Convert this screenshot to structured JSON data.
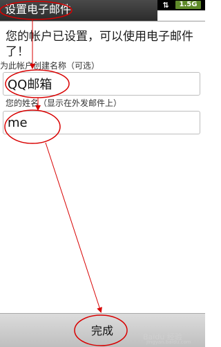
{
  "status_bar": {
    "arrows_icon": "sync-arrows-icon",
    "network_badge": "1.5G"
  },
  "header": {
    "title": "设置电子邮件"
  },
  "main": {
    "intro": "您的帐户已设置，可以使用电子邮件了！",
    "account_name_label": "为此帐户创建名称（可选）",
    "account_name_value": "QQ邮箱",
    "your_name_label": "您的姓名（显示在外发邮件上）",
    "your_name_value": "me"
  },
  "footer": {
    "done_label": "完成"
  },
  "watermark": {
    "text": "Baidu 经验",
    "sub": "jingyan.baidu.com"
  },
  "colors": {
    "annotation": "#d80000",
    "network_badge": "#5f8a2a",
    "title_bar": "#3a3a3a"
  }
}
